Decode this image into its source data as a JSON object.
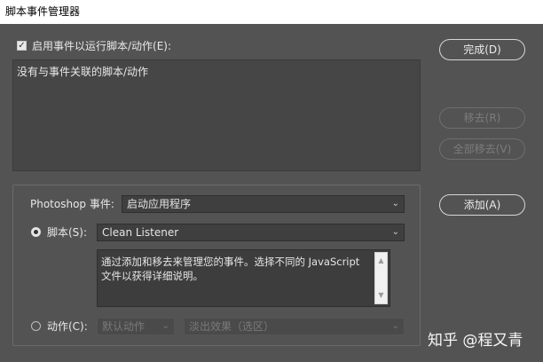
{
  "window": {
    "title": "脚本事件管理器"
  },
  "enable": {
    "label": "启用事件以运行脚本/动作(E):",
    "checked": true,
    "check_glyph": "✓"
  },
  "events_list": {
    "empty_text": "没有与事件关联的脚本/动作"
  },
  "buttons": {
    "done": "完成(D)",
    "remove": "移去(R)",
    "remove_all": "全部移去(V)",
    "add": "添加(A)"
  },
  "photoshop_event": {
    "label": "Photoshop 事件:",
    "value": "启动应用程序"
  },
  "script": {
    "label": "脚本(S):",
    "value": "Clean Listener",
    "selected": true
  },
  "description": {
    "text": "通过添加和移去来管理您的事件。选择不同的 JavaScript 文件以获得详细说明。"
  },
  "action": {
    "label": "动作(C):",
    "set_value": "默认动作",
    "action_value": "淡出效果（选区）",
    "selected": false
  },
  "icons": {
    "chevron": "chevron-down-icon",
    "scroll_up": "▲",
    "scroll_down": "▼"
  },
  "watermark": {
    "text": "知乎 @程又青"
  }
}
